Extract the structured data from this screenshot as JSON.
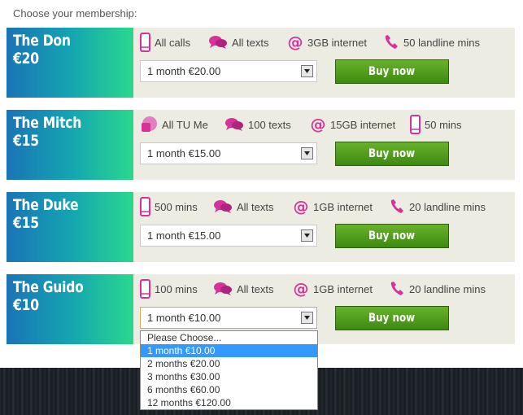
{
  "header": {
    "text": "Choose your membership:"
  },
  "plans": [
    {
      "name": "The Don",
      "price": "€20",
      "features": [
        {
          "icon": "phone-icon",
          "text": "All calls"
        },
        {
          "icon": "chat-bubbles-icon",
          "text": "All texts"
        },
        {
          "icon": "at-sign-icon",
          "text": "3GB internet"
        },
        {
          "icon": "landline-handset-icon",
          "text": "50 landline mins"
        }
      ],
      "select_value": "1 month €20.00",
      "buy_label": "Buy now"
    },
    {
      "name": "The Mitch",
      "price": "€15",
      "features": [
        {
          "icon": "tu-me-icon",
          "text": "All TU Me"
        },
        {
          "icon": "chat-bubbles-icon",
          "text": "100 texts"
        },
        {
          "icon": "at-sign-icon",
          "text": "15GB internet"
        },
        {
          "icon": "phone-icon",
          "text": "50 mins"
        }
      ],
      "select_value": "1 month €15.00",
      "buy_label": "Buy now"
    },
    {
      "name": "The Duke",
      "price": "€15",
      "features": [
        {
          "icon": "phone-icon",
          "text": "500 mins"
        },
        {
          "icon": "chat-bubbles-icon",
          "text": "All texts"
        },
        {
          "icon": "at-sign-icon",
          "text": "1GB internet"
        },
        {
          "icon": "landline-handset-icon",
          "text": "20 landline mins"
        }
      ],
      "select_value": "1 month €15.00",
      "buy_label": "Buy now"
    },
    {
      "name": "The Guido",
      "price": "€10",
      "features": [
        {
          "icon": "phone-icon",
          "text": "100 mins"
        },
        {
          "icon": "chat-bubbles-icon",
          "text": "All texts"
        },
        {
          "icon": "at-sign-icon",
          "text": "1GB internet"
        },
        {
          "icon": "landline-handset-icon",
          "text": "20 landline mins"
        }
      ],
      "select_value": "1 month €10.00",
      "buy_label": "Buy now"
    }
  ],
  "dropdown": {
    "options": [
      "Please Choose...",
      "1 month €10.00",
      "2 months €20.00",
      "3 months €30.00",
      "6 months €60.00",
      "12 months €120.00"
    ],
    "selected": "1 month €10.00"
  },
  "colors": {
    "accent_pink": "#d6339a",
    "buy_green": "#4f9e1c",
    "panel_bg": "#ecece2"
  }
}
